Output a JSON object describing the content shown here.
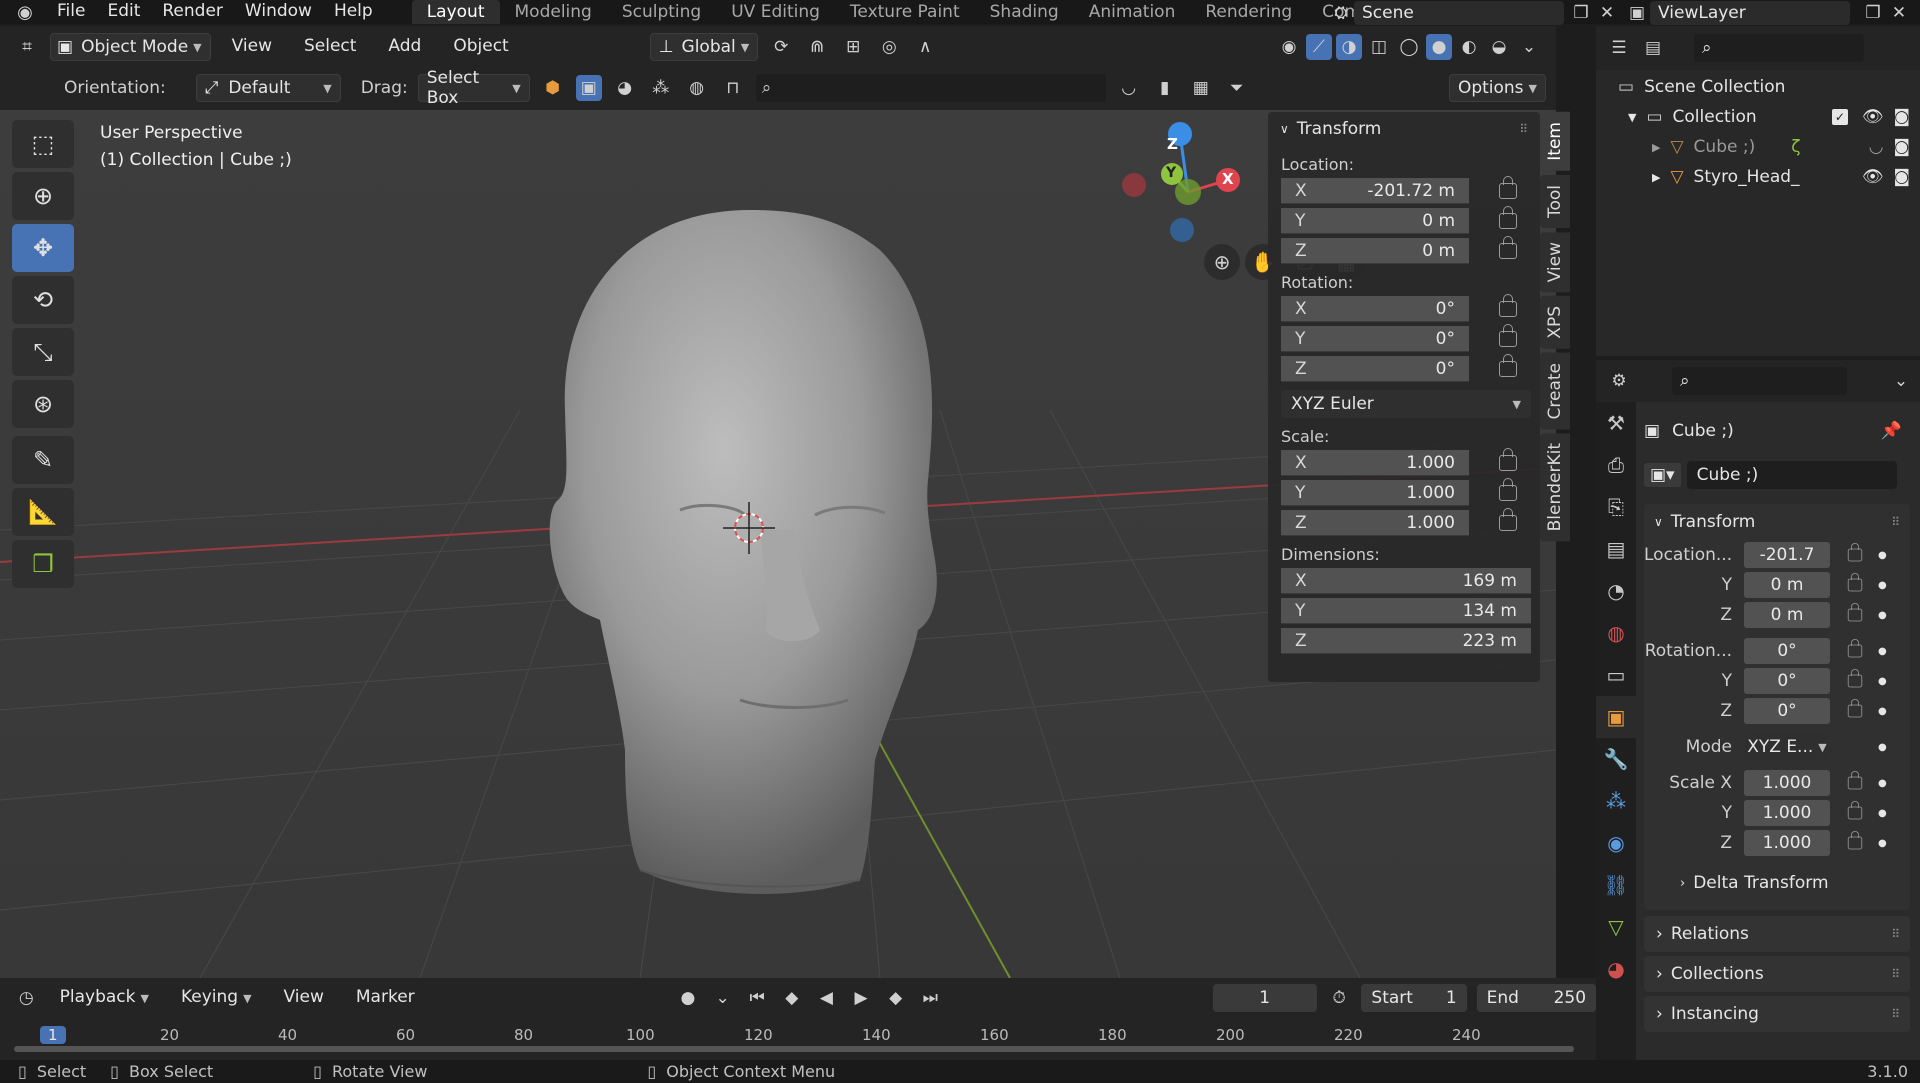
{
  "top_menu": [
    "File",
    "Edit",
    "Render",
    "Window",
    "Help"
  ],
  "workspace_tabs": [
    "Layout",
    "Modeling",
    "Sculpting",
    "UV Editing",
    "Texture Paint",
    "Shading",
    "Animation",
    "Rendering",
    "Compo"
  ],
  "scene_name": "Scene",
  "view_layer": "ViewLayer",
  "viewport_header": {
    "mode": "Object Mode",
    "menus": [
      "View",
      "Select",
      "Add",
      "Object"
    ],
    "transform_orientation": "Global",
    "orientation_label": "Orientation:",
    "orientation_value": "Default",
    "drag_label": "Drag:",
    "drag_value": "Select Box",
    "options_label": "Options"
  },
  "viewport_overlay": {
    "perspective": "User Perspective",
    "collection_info": "(1) Collection | Cube ;)"
  },
  "gizmo": {
    "x": "X",
    "y": "Y",
    "z": "Z"
  },
  "npanel": {
    "header": "Transform",
    "location_label": "Location:",
    "rotation_label": "Rotation:",
    "scale_label": "Scale:",
    "dimensions_label": "Dimensions:",
    "location": [
      {
        "axis": "X",
        "value": "-201.72 m"
      },
      {
        "axis": "Y",
        "value": "0 m"
      },
      {
        "axis": "Z",
        "value": "0 m"
      }
    ],
    "rotation": [
      {
        "axis": "X",
        "value": "0°"
      },
      {
        "axis": "Y",
        "value": "0°"
      },
      {
        "axis": "Z",
        "value": "0°"
      }
    ],
    "rotation_mode": "XYZ Euler",
    "scale": [
      {
        "axis": "X",
        "value": "1.000"
      },
      {
        "axis": "Y",
        "value": "1.000"
      },
      {
        "axis": "Z",
        "value": "1.000"
      }
    ],
    "dimensions": [
      {
        "axis": "X",
        "value": "169 m"
      },
      {
        "axis": "Y",
        "value": "134 m"
      },
      {
        "axis": "Z",
        "value": "223 m"
      }
    ]
  },
  "vertical_tabs": [
    "Item",
    "Tool",
    "View",
    "XPS",
    "Create",
    "BlenderKit"
  ],
  "outliner": {
    "scene_collection": "Scene Collection",
    "collection": "Collection",
    "items": [
      "Cube ;)",
      "Styro_Head_"
    ]
  },
  "properties": {
    "object_name": "Cube ;)",
    "object_name_field": "Cube ;)",
    "transform_header": "Transform",
    "location_label": "Location...",
    "location": [
      "-201.7",
      "0 m",
      "0 m"
    ],
    "rotation_label": "Rotation...",
    "rotation": [
      "0°",
      "0°",
      "0°"
    ],
    "mode_label": "Mode",
    "mode_value": "XYZ E...",
    "scale_label": "Scale X",
    "scale": [
      "1.000",
      "1.000",
      "1.000"
    ],
    "axis_y": "Y",
    "axis_z": "Z",
    "sections": [
      "Delta Transform",
      "Relations",
      "Collections",
      "Instancing"
    ]
  },
  "timeline": {
    "menus": [
      "Playback",
      "Keying",
      "View",
      "Marker"
    ],
    "current_frame": "1",
    "start_label": "Start",
    "start_value": "1",
    "end_label": "End",
    "end_value": "250",
    "ruler": [
      "1",
      "20",
      "40",
      "60",
      "80",
      "100",
      "120",
      "140",
      "160",
      "180",
      "200",
      "220",
      "240"
    ]
  },
  "statusbar": {
    "items": [
      "Select",
      "Box Select",
      "Rotate View",
      "Object Context Menu"
    ],
    "version": "3.1.0"
  },
  "colors": {
    "accent": "#4772b3",
    "x_axis": "#e0444e",
    "y_axis": "#8ec43e",
    "z_axis": "#3b8ee6"
  }
}
